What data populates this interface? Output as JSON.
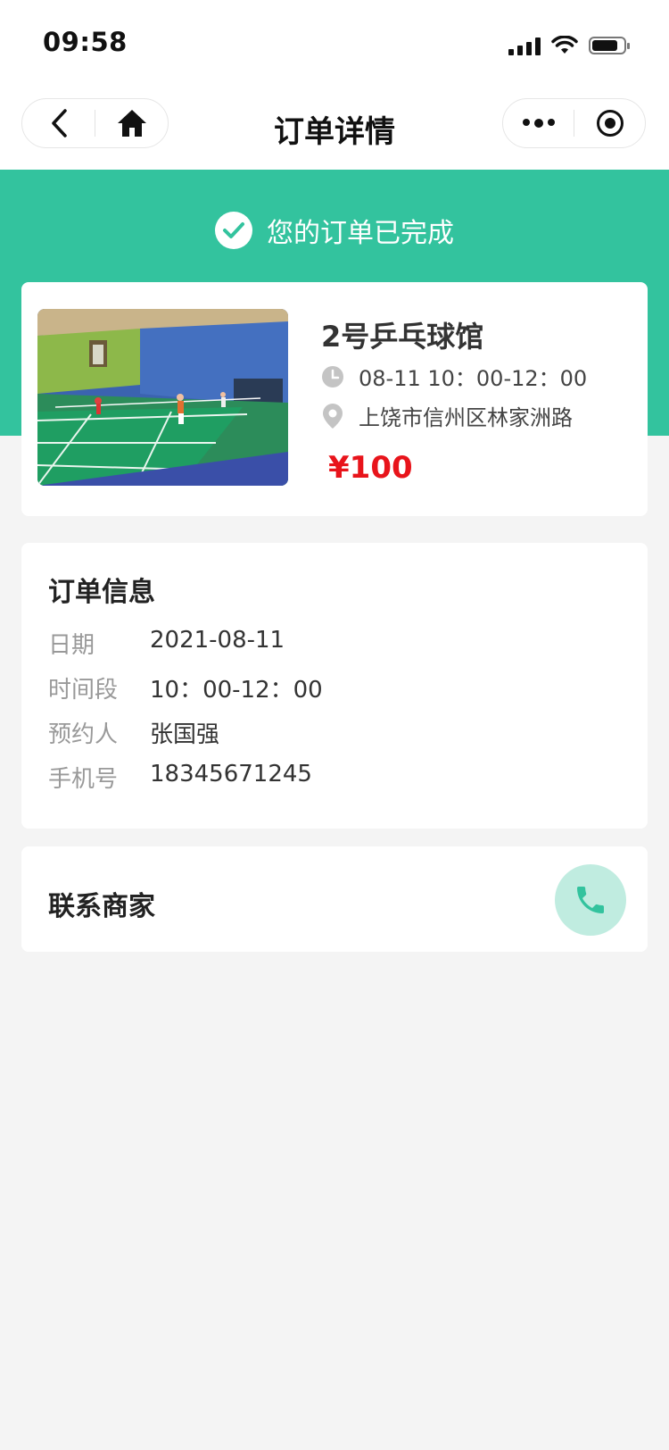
{
  "status_bar": {
    "time": "09:58"
  },
  "nav": {
    "title": "订单详情"
  },
  "banner": {
    "message": "您的订单已完成"
  },
  "venue": {
    "name": "2号乒乓球馆",
    "time": "08-11 10：00-12：00",
    "address": "上饶市信州区林家洲路",
    "price": "¥100"
  },
  "order_info": {
    "title": "订单信息",
    "rows": [
      {
        "label": "日期",
        "value": "2021-08-11"
      },
      {
        "label": "时间段",
        "value": "10：00-12：00"
      },
      {
        "label": "预约人",
        "value": "张国强"
      },
      {
        "label": "手机号",
        "value": "18345671245"
      }
    ]
  },
  "contact": {
    "label": "联系商家"
  },
  "colors": {
    "accent": "#33c39e",
    "price": "#e8141b",
    "background": "#f4f4f4"
  }
}
